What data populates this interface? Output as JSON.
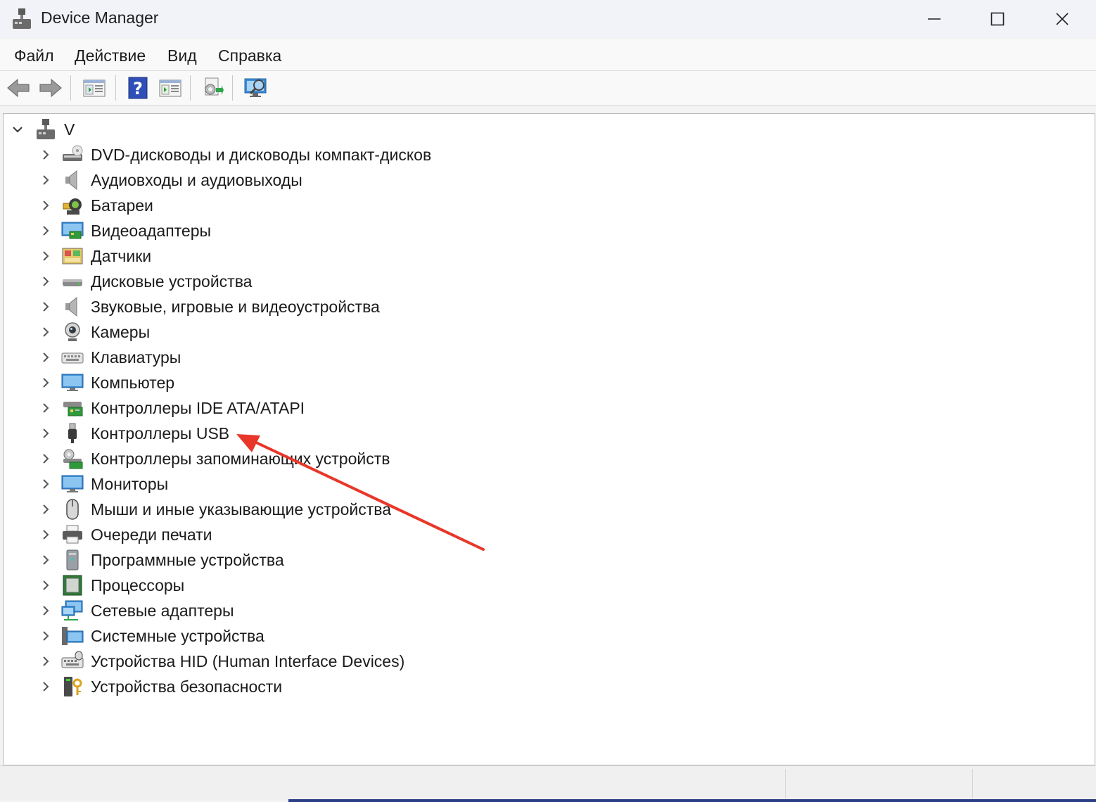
{
  "window": {
    "title": "Device Manager",
    "controls": [
      "minimize",
      "maximize",
      "close"
    ]
  },
  "menu": {
    "items": [
      {
        "label": "Файл"
      },
      {
        "label": "Действие"
      },
      {
        "label": "Вид"
      },
      {
        "label": "Справка"
      }
    ]
  },
  "toolbar": {
    "buttons": [
      "back-arrow-icon",
      "forward-arrow-icon",
      "properties-icon",
      "help-icon",
      "update-driver-icon",
      "scan-hardware-icon",
      "monitor-icon"
    ]
  },
  "tree": {
    "root": {
      "label": "V",
      "expanded": true
    },
    "categories": [
      {
        "label": "DVD-дисководы и дисководы компакт-дисков",
        "icon": "dvd-drive-icon"
      },
      {
        "label": "Аудиовходы и аудиовыходы",
        "icon": "speaker-icon"
      },
      {
        "label": "Батареи",
        "icon": "battery-icon"
      },
      {
        "label": "Видеоадаптеры",
        "icon": "display-adapter-icon"
      },
      {
        "label": "Датчики",
        "icon": "sensor-icon"
      },
      {
        "label": "Дисковые устройства",
        "icon": "disk-drive-icon"
      },
      {
        "label": "Звуковые, игровые и видеоустройства",
        "icon": "speaker-icon"
      },
      {
        "label": "Камеры",
        "icon": "camera-icon"
      },
      {
        "label": "Клавиатуры",
        "icon": "keyboard-icon"
      },
      {
        "label": "Компьютер",
        "icon": "computer-icon"
      },
      {
        "label": "Контроллеры IDE ATA/ATAPI",
        "icon": "ide-controller-icon"
      },
      {
        "label": "Контроллеры USB",
        "icon": "usb-icon"
      },
      {
        "label": "Контроллеры запоминающих устройств",
        "icon": "storage-controller-icon"
      },
      {
        "label": "Мониторы",
        "icon": "monitor-icon"
      },
      {
        "label": "Мыши и иные указывающие устройства",
        "icon": "mouse-icon"
      },
      {
        "label": "Очереди печати",
        "icon": "printer-icon"
      },
      {
        "label": "Программные устройства",
        "icon": "software-device-icon"
      },
      {
        "label": "Процессоры",
        "icon": "processor-icon"
      },
      {
        "label": "Сетевые адаптеры",
        "icon": "network-adapter-icon"
      },
      {
        "label": "Системные устройства",
        "icon": "system-device-icon"
      },
      {
        "label": "Устройства HID (Human Interface Devices)",
        "icon": "hid-icon"
      },
      {
        "label": "Устройства безопасности",
        "icon": "security-device-icon"
      }
    ]
  },
  "annotation": {
    "type": "arrow",
    "color": "#e8372a",
    "target": "Контроллеры USB"
  }
}
